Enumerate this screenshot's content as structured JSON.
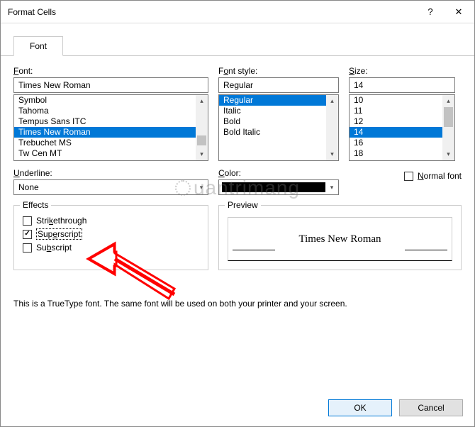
{
  "titlebar": {
    "title": "Format Cells",
    "help": "?",
    "close": "✕"
  },
  "tabs": {
    "font": "Font"
  },
  "labels": {
    "font": "Font:",
    "style": "Font style:",
    "size": "Size:",
    "underline": "Underline:",
    "color": "Color:",
    "effects": "Effects",
    "preview": "Preview",
    "normal_font": "Normal font"
  },
  "font": {
    "value": "Times New Roman",
    "items": [
      "Symbol",
      "Tahoma",
      "Tempus Sans ITC",
      "Times New Roman",
      "Trebuchet MS",
      "Tw Cen MT"
    ],
    "selected_index": 3
  },
  "style": {
    "value": "Regular",
    "items": [
      "Regular",
      "Italic",
      "Bold",
      "Bold Italic"
    ],
    "selected_index": 0
  },
  "size": {
    "value": "14",
    "items": [
      "10",
      "11",
      "12",
      "14",
      "16",
      "18"
    ],
    "selected_index": 3
  },
  "underline": {
    "value": "None"
  },
  "color": {
    "value": "#000000"
  },
  "normal_font_checked": false,
  "effects": {
    "strikethrough": {
      "label": "Strikethrough",
      "checked": false
    },
    "superscript": {
      "label": "Superscript",
      "checked": true
    },
    "subscript": {
      "label": "Subscript",
      "checked": false
    }
  },
  "preview_text": "Times New Roman",
  "note": "This is a TrueType font.  The same font will be used on both your printer and your screen.",
  "buttons": {
    "ok": "OK",
    "cancel": "Cancel"
  },
  "watermark": "uantrimang"
}
